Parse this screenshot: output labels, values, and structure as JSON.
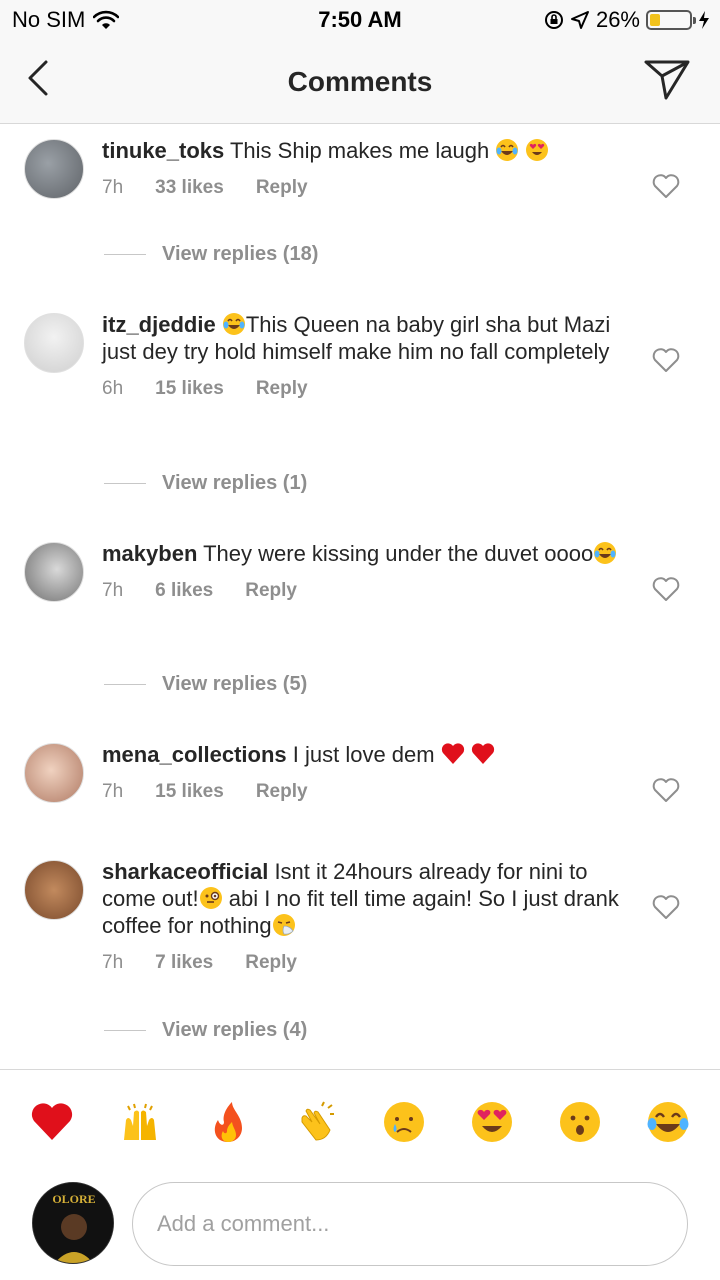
{
  "status_bar": {
    "carrier": "No SIM",
    "time": "7:50 AM",
    "battery_percent": "26%",
    "battery_level": 0.26,
    "battery_color": "#f2c21b"
  },
  "header": {
    "title": "Comments",
    "back_icon": "chevron-left-icon",
    "share_icon": "paper-plane-icon"
  },
  "comments": [
    {
      "username": "tinuke_toks",
      "text": "This Ship makes me laugh",
      "emojis": [
        "tears-of-joy",
        "heart-eyes"
      ],
      "time": "7h",
      "likes": "33 likes",
      "reply": "Reply",
      "view_replies": "View replies (18)"
    },
    {
      "username": "itz_djeddie",
      "text_before_emoji": "",
      "text": "This Queen na baby girl sha but Mazi just dey try hold himself make him no fall completely",
      "emojis": [
        "tears-of-joy"
      ],
      "time": "6h",
      "likes": "15 likes",
      "reply": "Reply",
      "view_replies": "View replies (1)"
    },
    {
      "username": "makyben",
      "text": "They were kissing under the duvet oooo",
      "emojis": [
        "tears-of-joy"
      ],
      "time": "7h",
      "likes": "6 likes",
      "reply": "Reply",
      "view_replies": "View replies (5)"
    },
    {
      "username": "mena_collections",
      "text": "I just love dem",
      "emojis": [
        "red-heart",
        "red-heart"
      ],
      "time": "7h",
      "likes": "15 likes",
      "reply": "Reply"
    },
    {
      "username": "sharkaceofficial",
      "text_1": "Isnt it 24hours already for nini to come out!",
      "text_2": "abi I no fit tell time again! So I just drank coffee for nothing",
      "emojis": [
        "face-with-monocle",
        "sneezing-face"
      ],
      "time": "7h",
      "likes": "7 likes",
      "reply": "Reply",
      "view_replies": "View replies (4)"
    }
  ],
  "quick_reactions": [
    "red-heart",
    "raising-hands",
    "fire",
    "clapping-hands",
    "crying-face",
    "heart-eyes",
    "surprised-face",
    "tears-of-joy"
  ],
  "composer": {
    "placeholder": "Add a comment...",
    "avatar_text": "OLORE"
  }
}
